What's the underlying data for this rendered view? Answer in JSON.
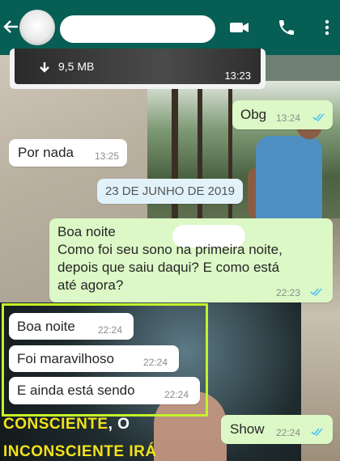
{
  "header": {
    "contact_name": "",
    "icons": [
      "back-arrow-icon",
      "video-call-icon",
      "phone-icon",
      "more-options-icon"
    ],
    "color": "#075e54"
  },
  "attachment": {
    "size": "9,5 MB",
    "time": "13:23",
    "icon": "download-icon"
  },
  "messages": [
    {
      "direction": "out",
      "text": "Obg",
      "time": "13:24",
      "status": "read"
    },
    {
      "direction": "in",
      "text": "Por nada",
      "time": "13:25"
    },
    {
      "direction": "out",
      "lines": [
        "Boa noite",
        "Como foi seu sono na primeira noite,",
        "depois que saiu daqui? E como está",
        "até agora?"
      ],
      "time": "22:23",
      "status": "read"
    },
    {
      "direction": "in",
      "text": "Boa noite",
      "time": "22:24"
    },
    {
      "direction": "in",
      "text": "Foi maravilhoso",
      "time": "22:24"
    },
    {
      "direction": "in",
      "text": "E ainda está sendo",
      "time": "22:24"
    },
    {
      "direction": "out",
      "text": "Show",
      "time": "22:24",
      "status": "read"
    }
  ],
  "date_separator": "23 DE JUNHO DE 2019",
  "wallpaper_text": {
    "line1_highlight": "CONSCIENTE",
    "line1_rest": ", O",
    "line2": "INCONSCIENTE IRÁ"
  },
  "colors": {
    "incoming": "#ffffff",
    "outgoing": "#dcf8c6",
    "ticks": "#4fc3f7",
    "highlight_box": "#c3f32b"
  }
}
